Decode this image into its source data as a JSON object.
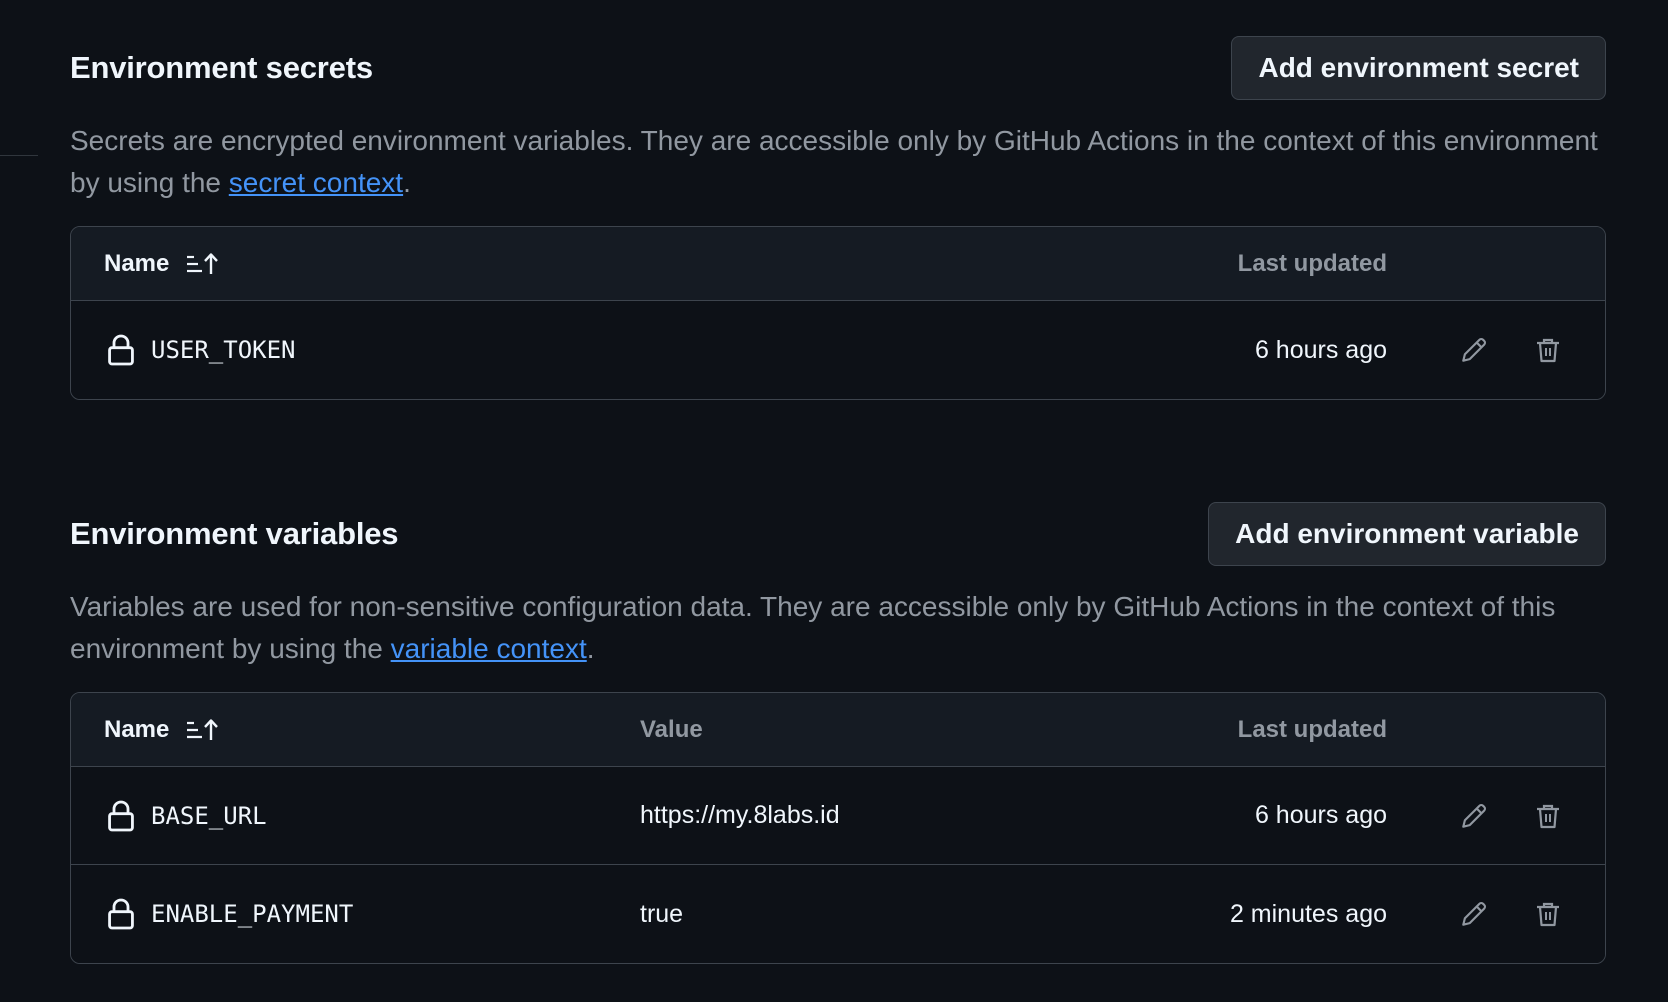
{
  "secrets": {
    "title": "Environment secrets",
    "add_button": "Add environment secret",
    "description_before": "Secrets are encrypted environment variables. They are accessible only by GitHub Actions in the context of this environment by using the ",
    "description_link": "secret context",
    "description_after": ".",
    "columns": {
      "name": "Name",
      "last_updated": "Last updated"
    },
    "rows": [
      {
        "name": "USER_TOKEN",
        "last_updated": "6 hours ago"
      }
    ]
  },
  "variables": {
    "title": "Environment variables",
    "add_button": "Add environment variable",
    "description_before": "Variables are used for non-sensitive configuration data. They are accessible only by GitHub Actions in the context of this environment by using the ",
    "description_link": "variable context",
    "description_after": ".",
    "columns": {
      "name": "Name",
      "value": "Value",
      "last_updated": "Last updated"
    },
    "rows": [
      {
        "name": "BASE_URL",
        "value": "https://my.8labs.id",
        "last_updated": "6 hours ago"
      },
      {
        "name": "ENABLE_PAYMENT",
        "value": "true",
        "last_updated": "2 minutes ago"
      }
    ]
  },
  "icons": {
    "sort": "sort-ascending-icon",
    "lock": "lock-icon",
    "edit": "pencil-icon",
    "delete": "trash-icon"
  },
  "colors": {
    "background": "#0d1117",
    "header_row": "#151b23",
    "border": "#3d444d",
    "link": "#4493f8",
    "muted_text": "#9198a1"
  }
}
